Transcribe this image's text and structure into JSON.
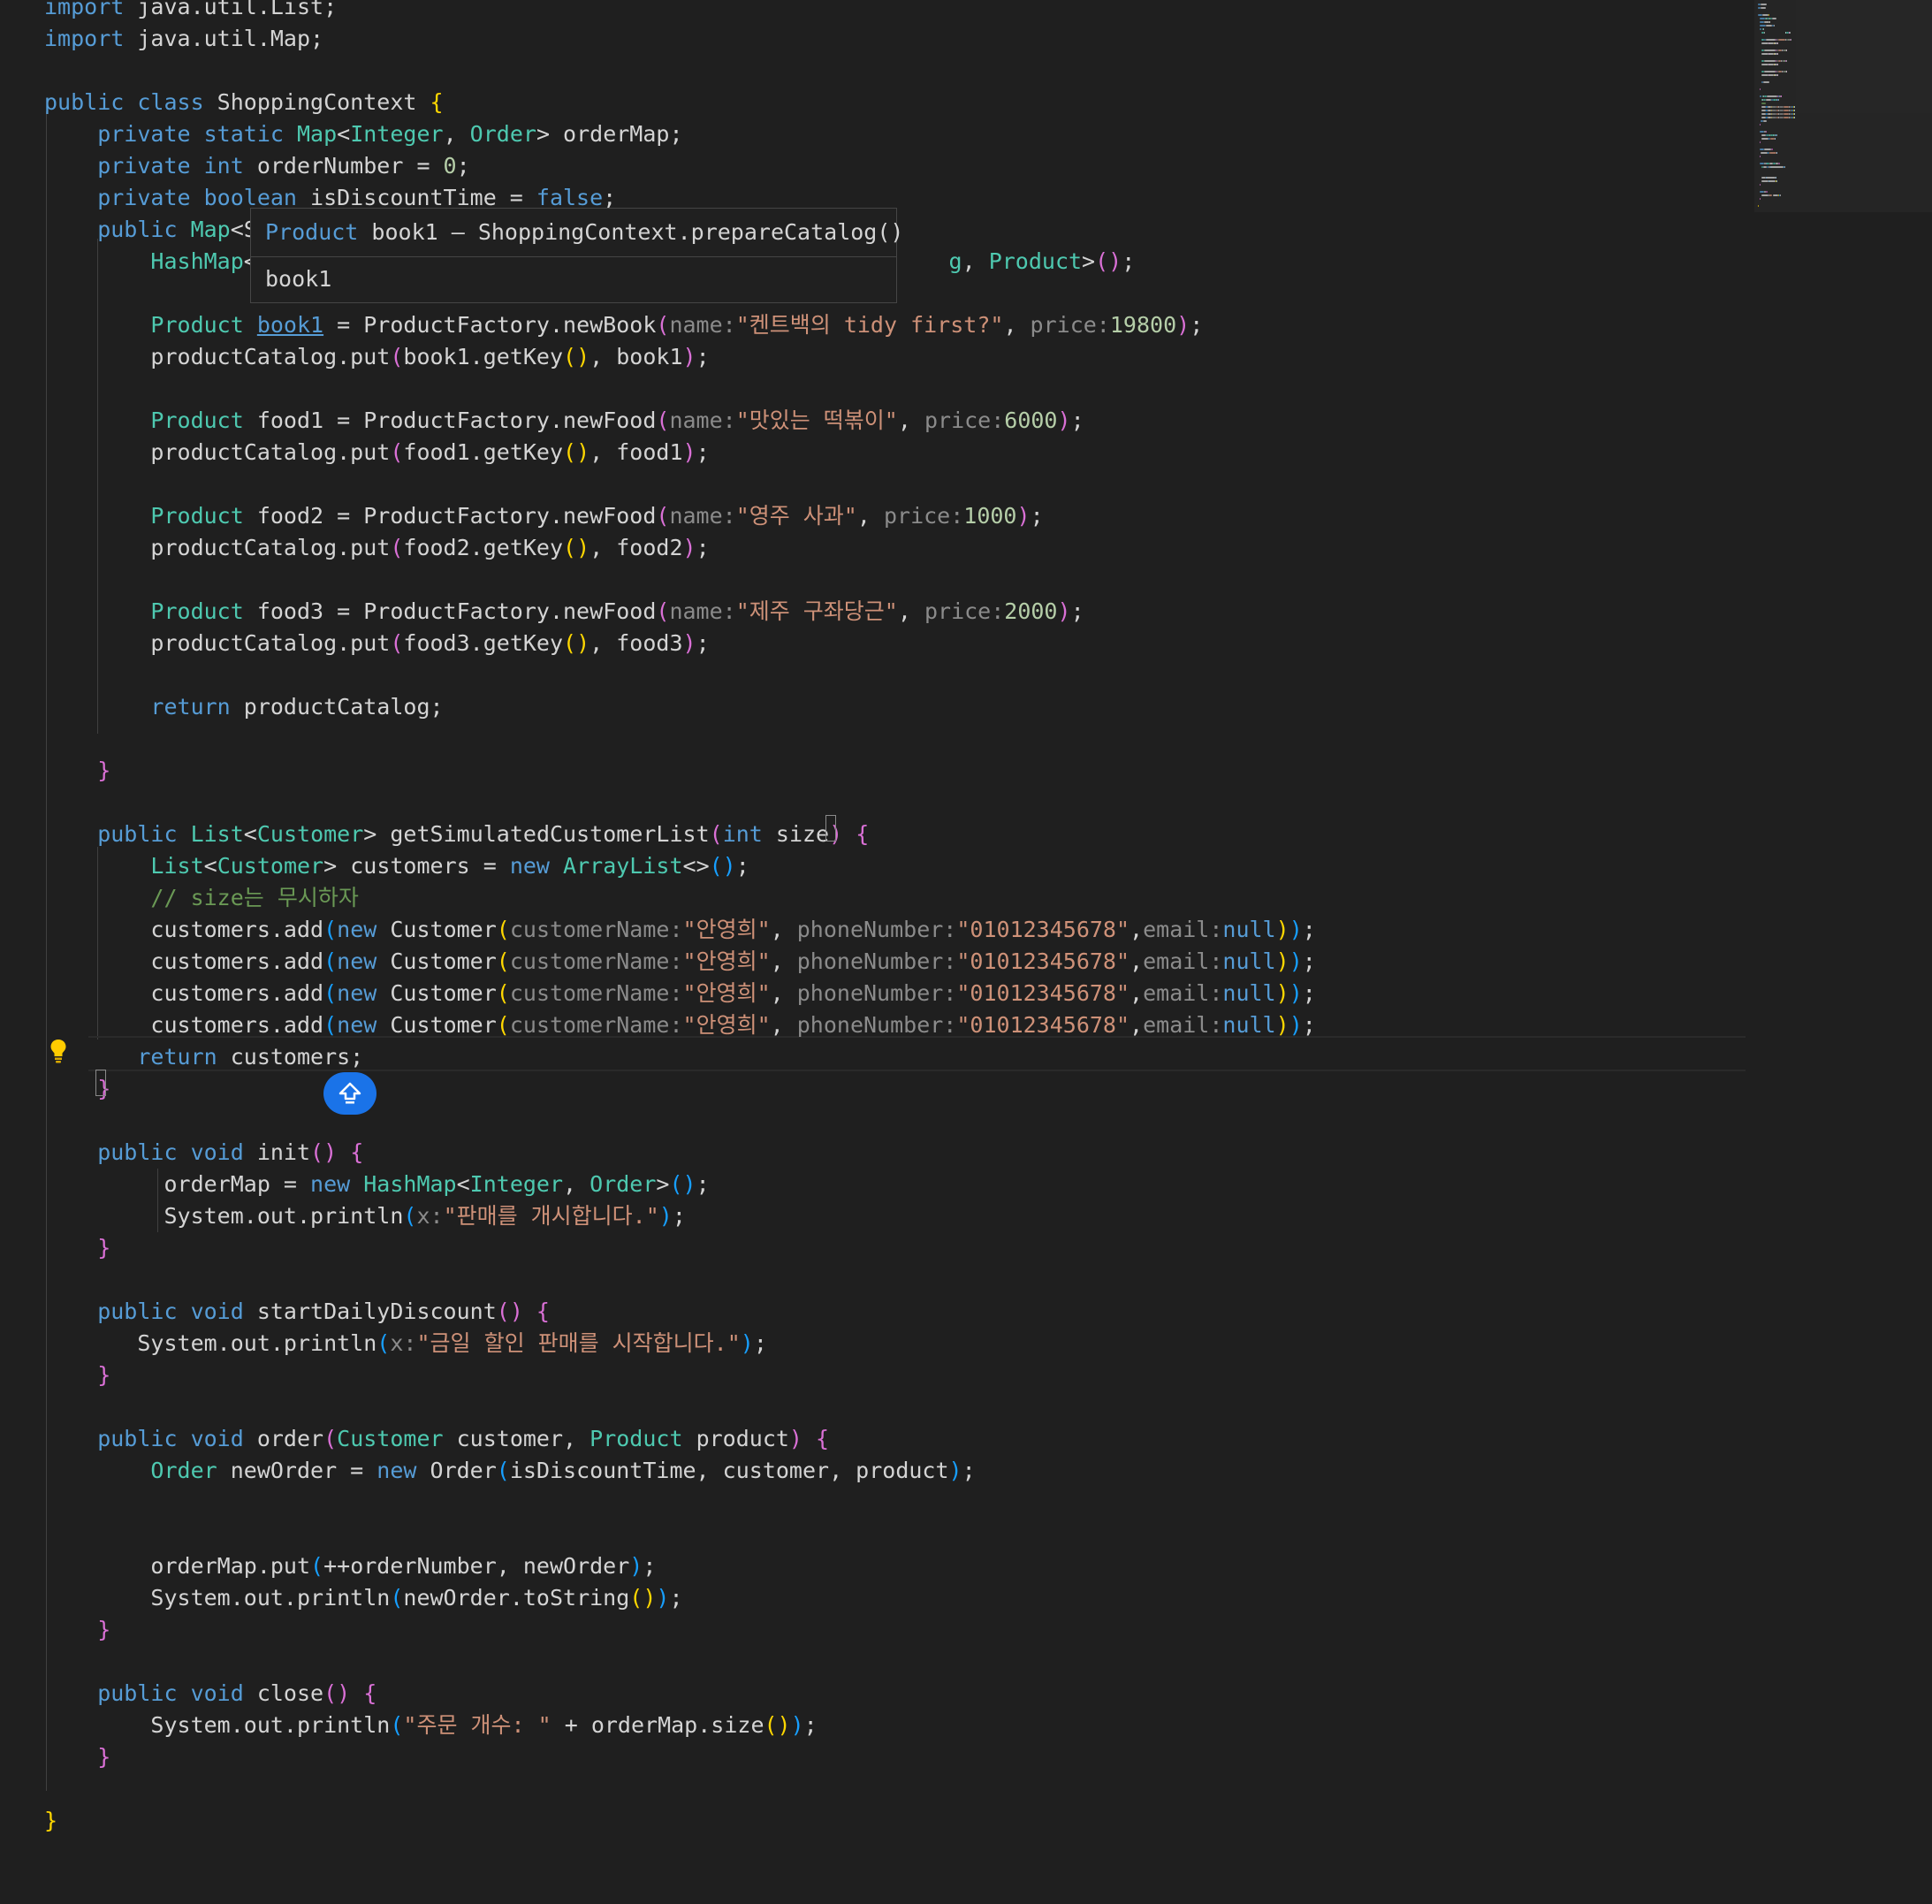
{
  "editor": {
    "language": "java",
    "lines": [
      [
        {
          "t": "import",
          "c": "kw"
        },
        {
          "t": " java.util.List;",
          "c": "tx"
        }
      ],
      [
        {
          "t": "import",
          "c": "kw"
        },
        {
          "t": " java.util.Map;",
          "c": "tx"
        }
      ],
      [],
      [
        {
          "t": "public class ",
          "c": "kw"
        },
        {
          "t": "ShoppingContext ",
          "c": "tx"
        },
        {
          "t": "{",
          "c": "b1"
        }
      ],
      [
        {
          "t": "    private static ",
          "c": "kw"
        },
        {
          "t": "Map",
          "c": "ty"
        },
        {
          "t": "<",
          "c": "tx"
        },
        {
          "t": "Integer",
          "c": "ty"
        },
        {
          "t": ", ",
          "c": "tx"
        },
        {
          "t": "Order",
          "c": "ty"
        },
        {
          "t": "> orderMap;",
          "c": "tx"
        }
      ],
      [
        {
          "t": "    private int ",
          "c": "kw"
        },
        {
          "t": "orderNumber = ",
          "c": "tx"
        },
        {
          "t": "0",
          "c": "nu"
        },
        {
          "t": ";",
          "c": "tx"
        }
      ],
      [
        {
          "t": "    private boolean ",
          "c": "kw"
        },
        {
          "t": "isDiscountTime = ",
          "c": "tx"
        },
        {
          "t": "false",
          "c": "kw"
        },
        {
          "t": ";",
          "c": "tx"
        }
      ],
      [
        {
          "t": "    public ",
          "c": "kw"
        },
        {
          "t": "Map",
          "c": "ty"
        },
        {
          "t": "<S",
          "c": "tx"
        }
      ],
      [
        {
          "t": "        HashMap",
          "c": "ty"
        },
        {
          "t": "<",
          "c": "tx"
        },
        {
          "t": "                                                    ",
          "c": "tx"
        },
        {
          "t": "g",
          "c": "ty"
        },
        {
          "t": ", ",
          "c": "tx"
        },
        {
          "t": "Product",
          "c": "ty"
        },
        {
          "t": ">",
          "c": "tx"
        },
        {
          "t": "()",
          "c": "b2"
        },
        {
          "t": ";",
          "c": "tx"
        }
      ],
      [],
      [
        {
          "t": "        Product ",
          "c": "ty"
        },
        {
          "t": "book1",
          "c": "ul"
        },
        {
          "t": " = ProductFactory.newBook",
          "c": "tx"
        },
        {
          "t": "(",
          "c": "b2"
        },
        {
          "t": "name:",
          "c": "hn"
        },
        {
          "t": "\"켄트백의 tidy first?\"",
          "c": "st"
        },
        {
          "t": ", ",
          "c": "tx"
        },
        {
          "t": "price:",
          "c": "hn"
        },
        {
          "t": "19800",
          "c": "nu"
        },
        {
          "t": ")",
          "c": "b2"
        },
        {
          "t": ";",
          "c": "tx"
        }
      ],
      [
        {
          "t": "        productCatalog.put",
          "c": "tx"
        },
        {
          "t": "(",
          "c": "b2"
        },
        {
          "t": "book1.getKey",
          "c": "tx"
        },
        {
          "t": "()",
          "c": "b1"
        },
        {
          "t": ", book1",
          "c": "tx"
        },
        {
          "t": ")",
          "c": "b2"
        },
        {
          "t": ";",
          "c": "tx"
        }
      ],
      [],
      [
        {
          "t": "        Product ",
          "c": "ty"
        },
        {
          "t": "food1 = ProductFactory.newFood",
          "c": "tx"
        },
        {
          "t": "(",
          "c": "b2"
        },
        {
          "t": "name:",
          "c": "hn"
        },
        {
          "t": "\"맛있는 떡볶이\"",
          "c": "st"
        },
        {
          "t": ", ",
          "c": "tx"
        },
        {
          "t": "price:",
          "c": "hn"
        },
        {
          "t": "6000",
          "c": "nu"
        },
        {
          "t": ")",
          "c": "b2"
        },
        {
          "t": ";",
          "c": "tx"
        }
      ],
      [
        {
          "t": "        productCatalog.put",
          "c": "tx"
        },
        {
          "t": "(",
          "c": "b2"
        },
        {
          "t": "food1.getKey",
          "c": "tx"
        },
        {
          "t": "()",
          "c": "b1"
        },
        {
          "t": ", food1",
          "c": "tx"
        },
        {
          "t": ")",
          "c": "b2"
        },
        {
          "t": ";",
          "c": "tx"
        }
      ],
      [],
      [
        {
          "t": "        Product ",
          "c": "ty"
        },
        {
          "t": "food2 = ProductFactory.newFood",
          "c": "tx"
        },
        {
          "t": "(",
          "c": "b2"
        },
        {
          "t": "name:",
          "c": "hn"
        },
        {
          "t": "\"영주 사과\"",
          "c": "st"
        },
        {
          "t": ", ",
          "c": "tx"
        },
        {
          "t": "price:",
          "c": "hn"
        },
        {
          "t": "1000",
          "c": "nu"
        },
        {
          "t": ")",
          "c": "b2"
        },
        {
          "t": ";",
          "c": "tx"
        }
      ],
      [
        {
          "t": "        productCatalog.put",
          "c": "tx"
        },
        {
          "t": "(",
          "c": "b2"
        },
        {
          "t": "food2.getKey",
          "c": "tx"
        },
        {
          "t": "()",
          "c": "b1"
        },
        {
          "t": ", food2",
          "c": "tx"
        },
        {
          "t": ")",
          "c": "b2"
        },
        {
          "t": ";",
          "c": "tx"
        }
      ],
      [],
      [
        {
          "t": "        Product ",
          "c": "ty"
        },
        {
          "t": "food3 = ProductFactory.newFood",
          "c": "tx"
        },
        {
          "t": "(",
          "c": "b2"
        },
        {
          "t": "name:",
          "c": "hn"
        },
        {
          "t": "\"제주 구좌당근\"",
          "c": "st"
        },
        {
          "t": ", ",
          "c": "tx"
        },
        {
          "t": "price:",
          "c": "hn"
        },
        {
          "t": "2000",
          "c": "nu"
        },
        {
          "t": ")",
          "c": "b2"
        },
        {
          "t": ";",
          "c": "tx"
        }
      ],
      [
        {
          "t": "        productCatalog.put",
          "c": "tx"
        },
        {
          "t": "(",
          "c": "b2"
        },
        {
          "t": "food3.getKey",
          "c": "tx"
        },
        {
          "t": "()",
          "c": "b1"
        },
        {
          "t": ", food3",
          "c": "tx"
        },
        {
          "t": ")",
          "c": "b2"
        },
        {
          "t": ";",
          "c": "tx"
        }
      ],
      [],
      [
        {
          "t": "        return ",
          "c": "kw"
        },
        {
          "t": "productCatalog;",
          "c": "tx"
        }
      ],
      [],
      [
        {
          "t": "    }",
          "c": "b2"
        }
      ],
      [],
      [
        {
          "t": "    public ",
          "c": "kw"
        },
        {
          "t": "List",
          "c": "ty"
        },
        {
          "t": "<",
          "c": "tx"
        },
        {
          "t": "Customer",
          "c": "ty"
        },
        {
          "t": "> getSimulatedCustomerList",
          "c": "tx"
        },
        {
          "t": "(",
          "c": "b2"
        },
        {
          "t": "int ",
          "c": "kw"
        },
        {
          "t": "size",
          "c": "tx"
        },
        {
          "t": ") ",
          "c": "b2"
        },
        {
          "t": "{",
          "c": "b2"
        }
      ],
      [
        {
          "t": "        List",
          "c": "ty"
        },
        {
          "t": "<",
          "c": "tx"
        },
        {
          "t": "Customer",
          "c": "ty"
        },
        {
          "t": "> customers = ",
          "c": "tx"
        },
        {
          "t": "new ",
          "c": "kw"
        },
        {
          "t": "ArrayList",
          "c": "ty"
        },
        {
          "t": "<>",
          "c": "tx"
        },
        {
          "t": "()",
          "c": "b3"
        },
        {
          "t": ";",
          "c": "tx"
        }
      ],
      [
        {
          "t": "        // size는 무시하자",
          "c": "cm"
        }
      ],
      [
        {
          "t": "        customers.add",
          "c": "tx"
        },
        {
          "t": "(",
          "c": "b3"
        },
        {
          "t": "new ",
          "c": "kw"
        },
        {
          "t": "Customer",
          "c": "tx"
        },
        {
          "t": "(",
          "c": "b1"
        },
        {
          "t": "customerName:",
          "c": "hn"
        },
        {
          "t": "\"안영희\"",
          "c": "st"
        },
        {
          "t": ", ",
          "c": "tx"
        },
        {
          "t": "phoneNumber:",
          "c": "hn"
        },
        {
          "t": "\"01012345678\"",
          "c": "st"
        },
        {
          "t": ",",
          "c": "tx"
        },
        {
          "t": "email:",
          "c": "hn"
        },
        {
          "t": "null",
          "c": "kw"
        },
        {
          "t": ")",
          "c": "b1"
        },
        {
          "t": ")",
          "c": "b3"
        },
        {
          "t": ";",
          "c": "tx"
        }
      ],
      [
        {
          "t": "        customers.add",
          "c": "tx"
        },
        {
          "t": "(",
          "c": "b3"
        },
        {
          "t": "new ",
          "c": "kw"
        },
        {
          "t": "Customer",
          "c": "tx"
        },
        {
          "t": "(",
          "c": "b1"
        },
        {
          "t": "customerName:",
          "c": "hn"
        },
        {
          "t": "\"안영희\"",
          "c": "st"
        },
        {
          "t": ", ",
          "c": "tx"
        },
        {
          "t": "phoneNumber:",
          "c": "hn"
        },
        {
          "t": "\"01012345678\"",
          "c": "st"
        },
        {
          "t": ",",
          "c": "tx"
        },
        {
          "t": "email:",
          "c": "hn"
        },
        {
          "t": "null",
          "c": "kw"
        },
        {
          "t": ")",
          "c": "b1"
        },
        {
          "t": ")",
          "c": "b3"
        },
        {
          "t": ";",
          "c": "tx"
        }
      ],
      [
        {
          "t": "        customers.add",
          "c": "tx"
        },
        {
          "t": "(",
          "c": "b3"
        },
        {
          "t": "new ",
          "c": "kw"
        },
        {
          "t": "Customer",
          "c": "tx"
        },
        {
          "t": "(",
          "c": "b1"
        },
        {
          "t": "customerName:",
          "c": "hn"
        },
        {
          "t": "\"안영희\"",
          "c": "st"
        },
        {
          "t": ", ",
          "c": "tx"
        },
        {
          "t": "phoneNumber:",
          "c": "hn"
        },
        {
          "t": "\"01012345678\"",
          "c": "st"
        },
        {
          "t": ",",
          "c": "tx"
        },
        {
          "t": "email:",
          "c": "hn"
        },
        {
          "t": "null",
          "c": "kw"
        },
        {
          "t": ")",
          "c": "b1"
        },
        {
          "t": ")",
          "c": "b3"
        },
        {
          "t": ";",
          "c": "tx"
        }
      ],
      [
        {
          "t": "        customers.add",
          "c": "tx"
        },
        {
          "t": "(",
          "c": "b3"
        },
        {
          "t": "new ",
          "c": "kw"
        },
        {
          "t": "Customer",
          "c": "tx"
        },
        {
          "t": "(",
          "c": "b1"
        },
        {
          "t": "customerName:",
          "c": "hn"
        },
        {
          "t": "\"안영희\"",
          "c": "st"
        },
        {
          "t": ", ",
          "c": "tx"
        },
        {
          "t": "phoneNumber:",
          "c": "hn"
        },
        {
          "t": "\"01012345678\"",
          "c": "st"
        },
        {
          "t": ",",
          "c": "tx"
        },
        {
          "t": "email:",
          "c": "hn"
        },
        {
          "t": "null",
          "c": "kw"
        },
        {
          "t": ")",
          "c": "b1"
        },
        {
          "t": ")",
          "c": "b3"
        },
        {
          "t": ";",
          "c": "tx"
        }
      ],
      [
        {
          "t": "       return ",
          "c": "kw"
        },
        {
          "t": "customers;",
          "c": "tx"
        }
      ],
      [
        {
          "t": "    }",
          "c": "b2"
        }
      ],
      [],
      [
        {
          "t": "    public void ",
          "c": "kw"
        },
        {
          "t": "init",
          "c": "tx"
        },
        {
          "t": "() {",
          "c": "b2"
        }
      ],
      [
        {
          "t": "         orderMap = ",
          "c": "tx"
        },
        {
          "t": "new ",
          "c": "kw"
        },
        {
          "t": "HashMap",
          "c": "ty"
        },
        {
          "t": "<",
          "c": "tx"
        },
        {
          "t": "Integer",
          "c": "ty"
        },
        {
          "t": ", ",
          "c": "tx"
        },
        {
          "t": "Order",
          "c": "ty"
        },
        {
          "t": ">",
          "c": "tx"
        },
        {
          "t": "()",
          "c": "b3"
        },
        {
          "t": ";",
          "c": "tx"
        }
      ],
      [
        {
          "t": "         System.out.println",
          "c": "tx"
        },
        {
          "t": "(",
          "c": "b3"
        },
        {
          "t": "x:",
          "c": "hn"
        },
        {
          "t": "\"판매를 개시합니다.\"",
          "c": "st"
        },
        {
          "t": ")",
          "c": "b3"
        },
        {
          "t": ";",
          "c": "tx"
        }
      ],
      [
        {
          "t": "    }",
          "c": "b2"
        }
      ],
      [],
      [
        {
          "t": "    public void ",
          "c": "kw"
        },
        {
          "t": "startDailyDiscount",
          "c": "tx"
        },
        {
          "t": "() {",
          "c": "b2"
        }
      ],
      [
        {
          "t": "       System.out.println",
          "c": "tx"
        },
        {
          "t": "(",
          "c": "b3"
        },
        {
          "t": "x:",
          "c": "hn"
        },
        {
          "t": "\"금일 할인 판매를 시작합니다.\"",
          "c": "st"
        },
        {
          "t": ")",
          "c": "b3"
        },
        {
          "t": ";",
          "c": "tx"
        }
      ],
      [
        {
          "t": "    }",
          "c": "b2"
        }
      ],
      [],
      [
        {
          "t": "    public void ",
          "c": "kw"
        },
        {
          "t": "order",
          "c": "tx"
        },
        {
          "t": "(",
          "c": "b2"
        },
        {
          "t": "Customer ",
          "c": "ty"
        },
        {
          "t": "customer, ",
          "c": "tx"
        },
        {
          "t": "Product ",
          "c": "ty"
        },
        {
          "t": "product",
          "c": "tx"
        },
        {
          "t": ") {",
          "c": "b2"
        }
      ],
      [
        {
          "t": "        Order ",
          "c": "ty"
        },
        {
          "t": "newOrder = ",
          "c": "tx"
        },
        {
          "t": "new ",
          "c": "kw"
        },
        {
          "t": "Order",
          "c": "tx"
        },
        {
          "t": "(",
          "c": "b3"
        },
        {
          "t": "isDiscountTime, customer, product",
          "c": "tx"
        },
        {
          "t": ")",
          "c": "b3"
        },
        {
          "t": ";",
          "c": "tx"
        }
      ],
      [],
      [],
      [
        {
          "t": "        orderMap.put",
          "c": "tx"
        },
        {
          "t": "(",
          "c": "b3"
        },
        {
          "t": "++orderNumber, newOrder",
          "c": "tx"
        },
        {
          "t": ")",
          "c": "b3"
        },
        {
          "t": ";",
          "c": "tx"
        }
      ],
      [
        {
          "t": "        System.out.println",
          "c": "tx"
        },
        {
          "t": "(",
          "c": "b3"
        },
        {
          "t": "newOrder.toString",
          "c": "tx"
        },
        {
          "t": "()",
          "c": "b1"
        },
        {
          "t": ")",
          "c": "b3"
        },
        {
          "t": ";",
          "c": "tx"
        }
      ],
      [
        {
          "t": "    }",
          "c": "b2"
        }
      ],
      [],
      [
        {
          "t": "    public void ",
          "c": "kw"
        },
        {
          "t": "close",
          "c": "tx"
        },
        {
          "t": "() {",
          "c": "b2"
        }
      ],
      [
        {
          "t": "        System.out.println",
          "c": "tx"
        },
        {
          "t": "(",
          "c": "b3"
        },
        {
          "t": "\"주문 개수: \"",
          "c": "st"
        },
        {
          "t": " + orderMap.size",
          "c": "tx"
        },
        {
          "t": "()",
          "c": "b1"
        },
        {
          "t": ")",
          "c": "b3"
        },
        {
          "t": ";",
          "c": "tx"
        }
      ],
      [
        {
          "t": "    }",
          "c": "b2"
        }
      ],
      [],
      [
        {
          "t": "}",
          "c": "b1"
        }
      ]
    ]
  },
  "hover": {
    "signature_type": "Product",
    "signature_rest": " book1 – ShoppingContext.prepareCatalog()",
    "doc": "book1"
  },
  "icons": {
    "lightbulb": "lightbulb-icon",
    "scroll_up": "arrow-up-icon"
  },
  "colors": {
    "background": "#1f1f1f",
    "keyword": "#569cd6",
    "type": "#4ec9b0",
    "text": "#d4d4d4",
    "string": "#ce9178",
    "number": "#b5cea8",
    "comment": "#6a9955",
    "inlay_hint": "#8b8b8b",
    "bracket1": "#ffd700",
    "bracket2": "#da70d6",
    "bracket3": "#179fff",
    "accent": "#1a73e8"
  }
}
